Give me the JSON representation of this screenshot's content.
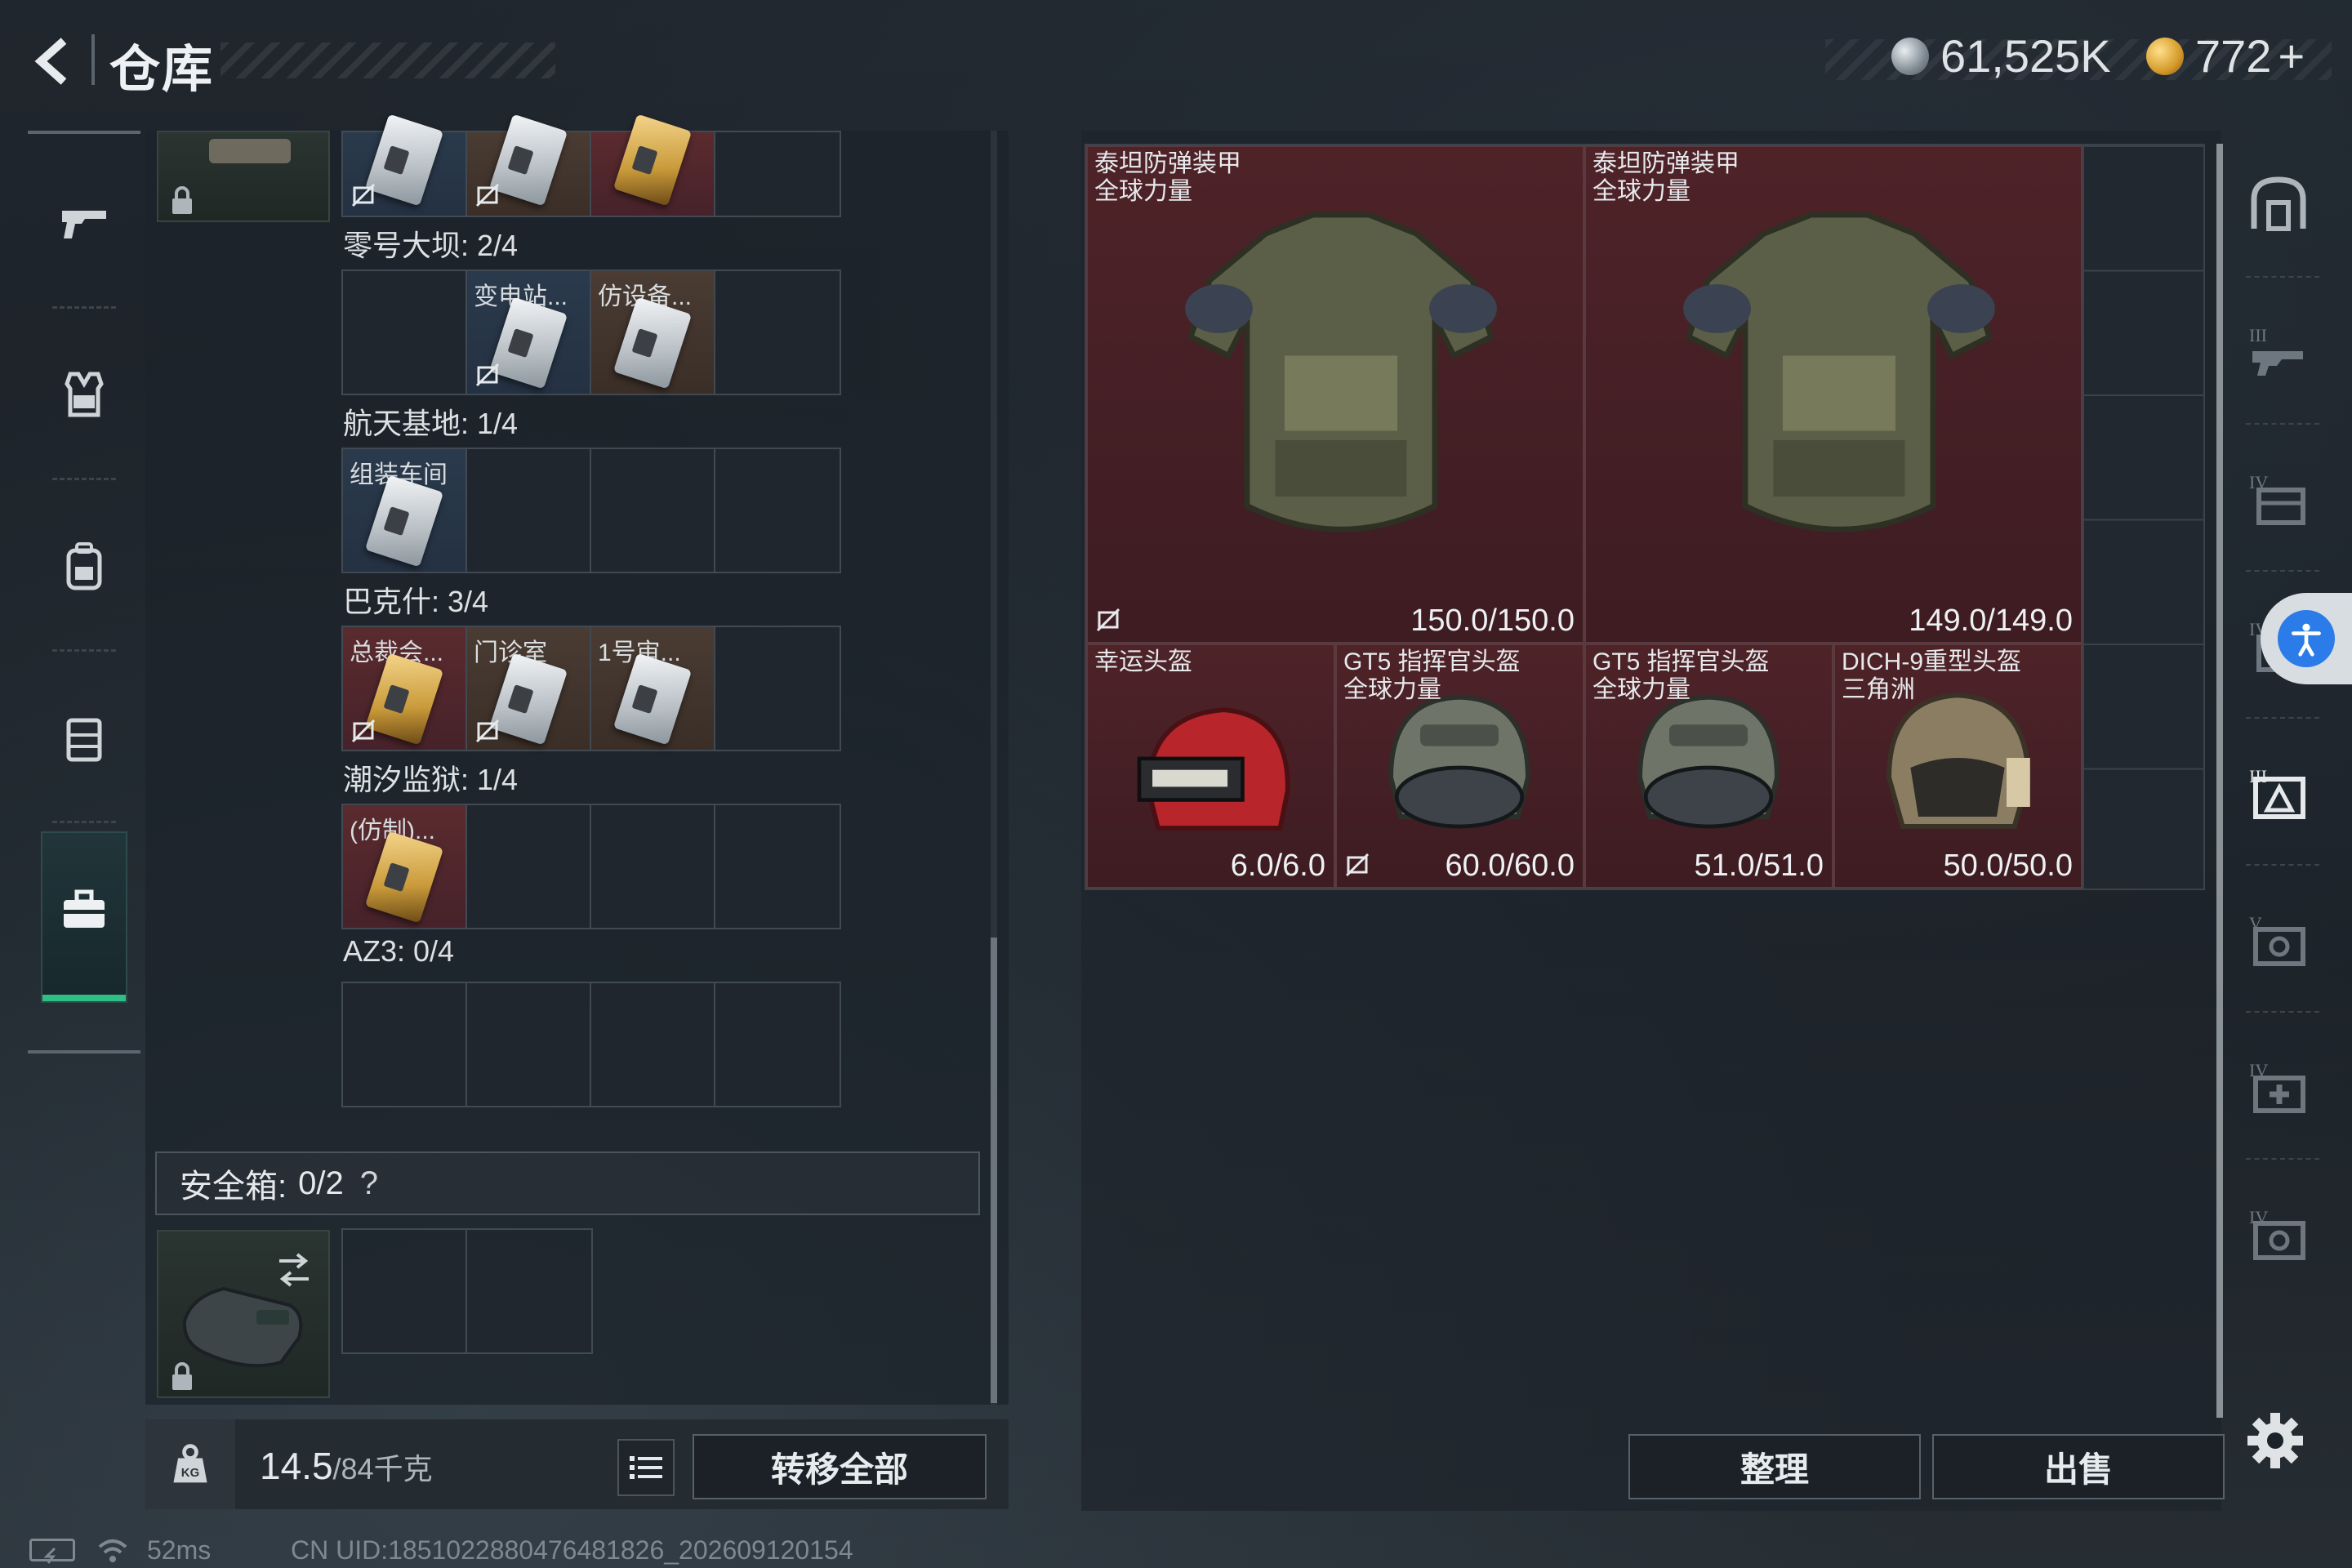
{
  "header": {
    "title": "仓库",
    "currency_silver": "61,525K",
    "currency_gold": "772",
    "currency_gold_suffix": "+"
  },
  "stash": {
    "groups": [
      {
        "name": "零号大坝: 2/4",
        "cards": [
          "变电站...",
          "仿设备..."
        ]
      },
      {
        "name": "航天基地: 1/4",
        "cards": [
          "组装车间"
        ]
      },
      {
        "name": "巴克什: 3/4",
        "cards": [
          "总裁会...",
          "门诊室",
          "1号审..."
        ]
      },
      {
        "name": "潮汐监狱: 1/4",
        "cards": [
          "(仿制)..."
        ]
      },
      {
        "name": "AZ3: 0/4",
        "cards": []
      }
    ],
    "safebox_label": "安全箱:",
    "safebox_count": "0/2",
    "safebox_help": "?"
  },
  "bottom": {
    "weight_value": "14.5",
    "weight_unit": "/84千克",
    "transfer_all": "转移全部"
  },
  "warehouse": {
    "items": [
      {
        "name": "泰坦防弹装甲\n全球力量",
        "durability": "150.0/150.0",
        "type": "armor",
        "no_sell": true
      },
      {
        "name": "泰坦防弹装甲\n全球力量",
        "durability": "149.0/149.0",
        "type": "armor",
        "no_sell": false
      },
      {
        "name": "幸运头盔",
        "durability": "6.0/6.0",
        "type": "helmet-red",
        "no_sell": false
      },
      {
        "name": "GT5 指挥官头盔\n全球力量",
        "durability": "60.0/60.0",
        "type": "helmet-gt5",
        "no_sell": true
      },
      {
        "name": "GT5 指挥官头盔\n全球力量",
        "durability": "51.0/51.0",
        "type": "helmet-gt5",
        "no_sell": false
      },
      {
        "name": "DICH-9重型头盔\n三角洲",
        "durability": "50.0/50.0",
        "type": "helmet-dich",
        "no_sell": false
      }
    ],
    "arrange": "整理",
    "sell": "出售"
  },
  "status": {
    "ping": "52ms",
    "uid": "CN UID:1851022880476481826_202609120154"
  },
  "colors": {
    "accent_green": "#2fbf86",
    "item_bg": "#4e2328",
    "access_blue": "#2b7be8"
  }
}
